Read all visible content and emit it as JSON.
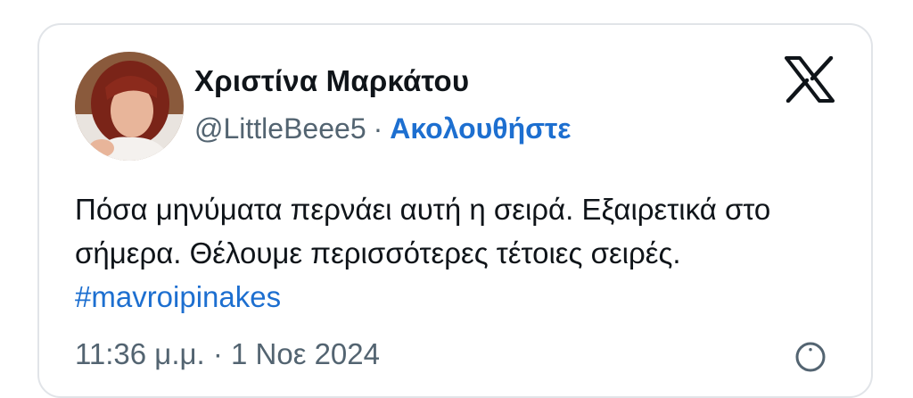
{
  "author": {
    "display_name": "Χριστίνα Μαρκάτου",
    "handle": "@LittleBeee5",
    "separator": "·",
    "follow_label": "Ακολουθήστε"
  },
  "tweet": {
    "text": "Πόσα μηνύματα περνάει αυτή η σειρά. Εξαιρετικά στο σήμερα. Θέλουμε περισσότερες τέτοιες σειρές. ",
    "hashtag": "#mavroipinakes",
    "timestamp": "11:36 μ.μ. · 1 Νοε 2024"
  },
  "icons": {
    "platform_logo": "x-logo-icon",
    "info": "info-icon"
  },
  "colors": {
    "link": "#1d6fd0",
    "text": "#0f1419",
    "secondary": "#536471",
    "border": "#e1e4e8"
  }
}
